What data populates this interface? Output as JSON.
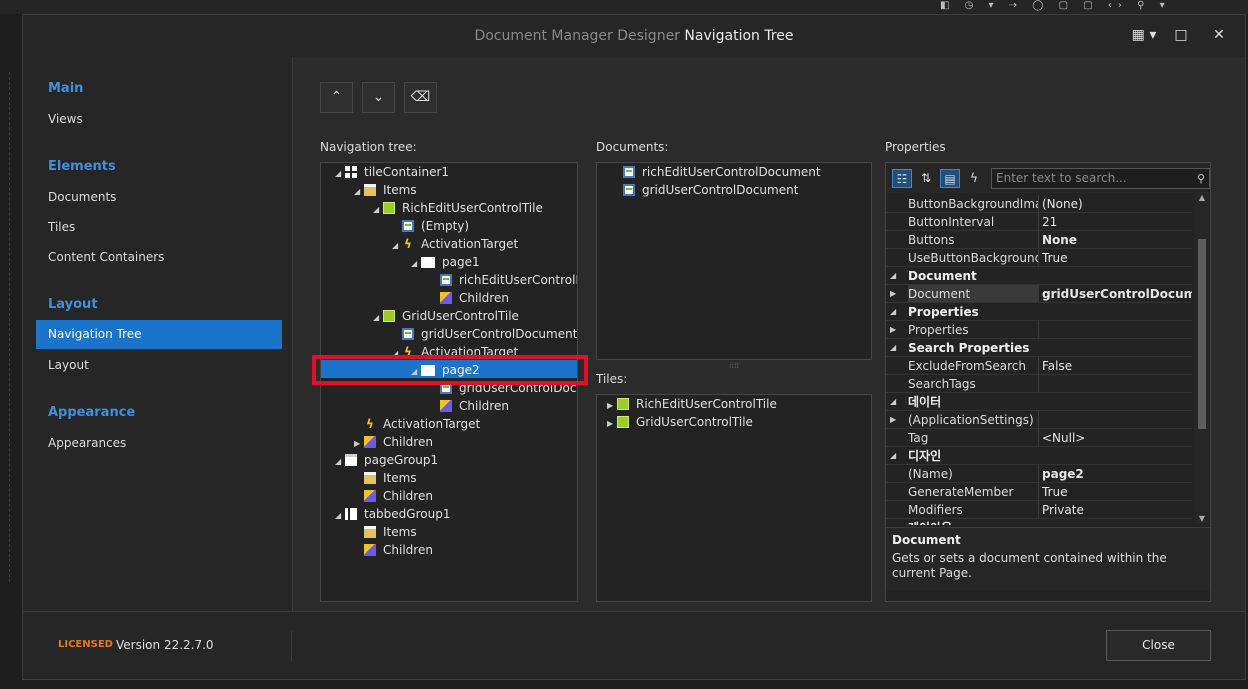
{
  "titlebar": {
    "dim_title": "Document Manager Designer",
    "bright_title": "Navigation Tree",
    "layout_icon": "grid-dropdown-icon",
    "maximize_label": "□",
    "close_label": "✕"
  },
  "sidebar": {
    "sections": [
      {
        "title": "Main",
        "items": [
          "Views"
        ]
      },
      {
        "title": "Elements",
        "items": [
          "Documents",
          "Tiles",
          "Content Containers"
        ]
      },
      {
        "title": "Layout",
        "items": [
          "Navigation Tree",
          "Layout"
        ]
      },
      {
        "title": "Appearance",
        "items": [
          "Appearances"
        ]
      }
    ],
    "selected": "Navigation Tree"
  },
  "toolbar": {
    "up_label": "⌃",
    "down_label": "⌄",
    "eraser_label": "⌫"
  },
  "nav_tree": {
    "label": "Navigation tree:",
    "rows": [
      {
        "text": "tileContainer1",
        "icon": "tile-container-icon",
        "expander": "◢"
      },
      {
        "text": "Items",
        "icon": "items-icon",
        "expander": "◢"
      },
      {
        "text": "RichEditUserControlTile",
        "icon": "tile-icon",
        "expander": "◢"
      },
      {
        "text": "(Empty)",
        "icon": "document-icon",
        "expander": ""
      },
      {
        "text": "ActivationTarget",
        "icon": "bolt-icon",
        "expander": "◢"
      },
      {
        "text": "page1",
        "icon": "page-icon",
        "expander": "◢"
      },
      {
        "text": "richEditUserControlDocument",
        "icon": "document-icon",
        "expander": ""
      },
      {
        "text": "Children",
        "icon": "children-icon",
        "expander": ""
      },
      {
        "text": "GridUserControlTile",
        "icon": "tile-icon",
        "expander": "◢"
      },
      {
        "text": "gridUserControlDocument",
        "icon": "document-icon",
        "expander": ""
      },
      {
        "text": "ActivationTarget",
        "icon": "bolt-icon",
        "expander": "◢"
      },
      {
        "text": "page2",
        "icon": "page-icon",
        "expander": "◢"
      },
      {
        "text": "gridUserControlDocument",
        "icon": "document-icon",
        "expander": ""
      },
      {
        "text": "Children",
        "icon": "children-icon",
        "expander": ""
      },
      {
        "text": "ActivationTarget",
        "icon": "bolt-icon",
        "expander": ""
      },
      {
        "text": "Children",
        "icon": "children-icon",
        "expander": "▶"
      },
      {
        "text": "pageGroup1",
        "icon": "page-group-icon",
        "expander": "◢"
      },
      {
        "text": "Items",
        "icon": "items-icon",
        "expander": ""
      },
      {
        "text": "Children",
        "icon": "children-icon",
        "expander": ""
      },
      {
        "text": "tabbedGroup1",
        "icon": "tabbed-group-icon",
        "expander": "◢"
      },
      {
        "text": "Items",
        "icon": "items-icon",
        "expander": ""
      },
      {
        "text": "Children",
        "icon": "children-icon",
        "expander": ""
      }
    ],
    "selected_row": "page2"
  },
  "documents": {
    "label": "Documents:",
    "items": [
      "richEditUserControlDocument",
      "gridUserControlDocument"
    ]
  },
  "tiles": {
    "label": "Tiles:",
    "items": [
      "RichEditUserControlTile",
      "GridUserControlTile"
    ]
  },
  "properties": {
    "label": "Properties",
    "search_placeholder": "Enter text to search...",
    "rows": [
      {
        "name": "ButtonBackgroundImag",
        "value": "(None)"
      },
      {
        "name": "ButtonInterval",
        "value": "21"
      },
      {
        "name": "Buttons",
        "value": "None",
        "bold": true
      },
      {
        "name": "UseButtonBackgroundI",
        "value": "True"
      },
      {
        "name": "Document",
        "category": true
      },
      {
        "name": "Document",
        "value": "gridUserControlDocumen",
        "bold": true,
        "expandable": true,
        "selected": true
      },
      {
        "name": "Properties",
        "category": true
      },
      {
        "name": "Properties",
        "value": "",
        "expandable": true
      },
      {
        "name": "Search Properties",
        "category": true
      },
      {
        "name": "ExcludeFromSearch",
        "value": "False"
      },
      {
        "name": "SearchTags",
        "value": ""
      },
      {
        "name": "데이터",
        "category": true
      },
      {
        "name": "(ApplicationSettings)",
        "value": "",
        "expandable": true
      },
      {
        "name": "Tag",
        "value": "<Null>"
      },
      {
        "name": "디자인",
        "category": true
      },
      {
        "name": "(Name)",
        "value": "page2",
        "bold": true
      },
      {
        "name": "GenerateMember",
        "value": "True"
      },
      {
        "name": "Modifiers",
        "value": "Private"
      },
      {
        "name": "레이아웃",
        "category": true
      }
    ],
    "description_title": "Document",
    "description_text": "Gets or sets a document contained within the current Page."
  },
  "footer": {
    "licensed": "LICENSED",
    "version": "Version 22.2.7.0",
    "close_label": "Close"
  },
  "colors": {
    "accent": "#1a74c9",
    "section_title": "#3f8fdc",
    "licensed": "#e07a1f",
    "highlight_box": "#e0102a"
  }
}
